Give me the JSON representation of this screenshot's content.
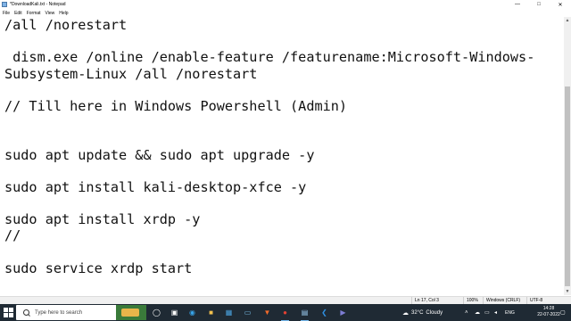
{
  "window": {
    "title": "*DownloadKali.txt - Notepad",
    "controls": {
      "minimize": "—",
      "maximize": "□",
      "close": "✕"
    }
  },
  "menu": [
    "File",
    "Edit",
    "Format",
    "View",
    "Help"
  ],
  "editor": {
    "lines": [
      "/all /norestart",
      "",
      " dism.exe /online /enable-feature /featurename:Microsoft-Windows-",
      "Subsystem-Linux /all /norestart",
      "",
      "// Till here in Windows Powershell (Admin)",
      "",
      "",
      "sudo apt update && sudo apt upgrade -y",
      "",
      "sudo apt install kali-desktop-xfce -y",
      "",
      "sudo apt install xrdp -y",
      "//",
      "",
      "sudo service xrdp start"
    ]
  },
  "statusbar": {
    "position": "Ln 17, Col 3",
    "zoom": "100%",
    "line_ending": "Windows (CRLF)",
    "encoding": "UTF-8"
  },
  "taskbar": {
    "search_placeholder": "Type here to search",
    "weather": {
      "temp": "32°C",
      "condition": "Cloudy"
    },
    "language": "ENG",
    "time": "14:28",
    "date": "22-07-2022",
    "icons": [
      "task-view",
      "edge",
      "file-explorer",
      "store",
      "brave",
      "chrome",
      "notepad",
      "vscode",
      "chat"
    ]
  },
  "colors": {
    "taskbar": "#1f2a34",
    "statusbar": "#f0f0f0",
    "scroll_thumb": "#c1c1c1"
  }
}
